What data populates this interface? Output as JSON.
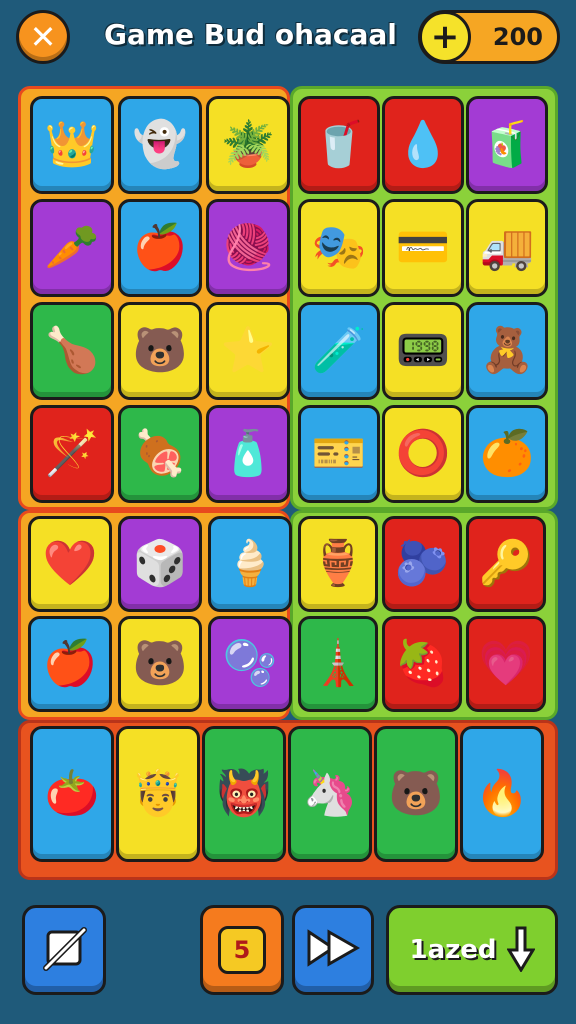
{
  "header": {
    "title": "Game Bud ohacaal",
    "coins": "200",
    "close_icon": "close-icon",
    "add_coins_icon": "plus-icon"
  },
  "board": {
    "tile_colors": {
      "blue": "#2fa7e8",
      "purple": "#a33bd4",
      "yellow": "#f5e025",
      "red": "#e0231c",
      "green": "#2eb84a"
    },
    "panel_a": [
      {
        "color": "blue",
        "icon": "crown-pot-icon",
        "glyph": "👑"
      },
      {
        "color": "blue",
        "icon": "king-ghost-icon",
        "glyph": "👻"
      },
      {
        "color": "yellow",
        "icon": "potted-plant-icon",
        "glyph": "🪴"
      },
      {
        "color": "purple",
        "icon": "carrot-slice-icon",
        "glyph": "🥕"
      },
      {
        "color": "blue",
        "icon": "apple-icon",
        "glyph": "🍎"
      },
      {
        "color": "purple",
        "icon": "yarn-ball-icon",
        "glyph": "🧶"
      },
      {
        "color": "green",
        "icon": "drumstick-icon",
        "glyph": "🍗"
      },
      {
        "color": "yellow",
        "icon": "bear-face-icon",
        "glyph": "🐻"
      },
      {
        "color": "yellow",
        "icon": "star-cherry-icon",
        "glyph": "⭐"
      },
      {
        "color": "red",
        "icon": "magic-wand-icon",
        "glyph": "🪄"
      },
      {
        "color": "green",
        "icon": "meat-leg-icon",
        "glyph": "🍖"
      },
      {
        "color": "purple",
        "icon": "bottle-icon",
        "glyph": "🧴"
      }
    ],
    "panel_b": [
      {
        "color": "red",
        "icon": "striped-cup-icon",
        "glyph": "🥤"
      },
      {
        "color": "red",
        "icon": "blue-leaf-icon",
        "glyph": "💧"
      },
      {
        "color": "purple",
        "icon": "glass-juice-icon",
        "glyph": "🧃"
      },
      {
        "color": "yellow",
        "icon": "feather-crown-icon",
        "glyph": "🎭"
      },
      {
        "color": "yellow",
        "icon": "card-icon",
        "glyph": "💳"
      },
      {
        "color": "yellow",
        "icon": "toy-truck-icon",
        "glyph": "🚚"
      },
      {
        "color": "blue",
        "icon": "potion-icon",
        "glyph": "🧪"
      },
      {
        "color": "yellow",
        "icon": "screen-icon",
        "glyph": "📟"
      },
      {
        "color": "blue",
        "icon": "bear-cup-icon",
        "glyph": "🧸"
      },
      {
        "color": "blue",
        "icon": "ticket-icon",
        "glyph": "🎫"
      },
      {
        "color": "yellow",
        "icon": "rings-icon",
        "glyph": "⭕"
      },
      {
        "color": "blue",
        "icon": "orange-icon",
        "glyph": "🍊"
      }
    ],
    "panel_c": [
      {
        "color": "yellow",
        "icon": "heart-icon",
        "glyph": "❤️"
      },
      {
        "color": "purple",
        "icon": "dice-card-icon",
        "glyph": "🎲"
      },
      {
        "color": "blue",
        "icon": "ice-cream-icon",
        "glyph": "🍦"
      },
      {
        "color": "blue",
        "icon": "apple-red-icon",
        "glyph": "🍎"
      },
      {
        "color": "yellow",
        "icon": "bear-mug-icon",
        "glyph": "🐻"
      },
      {
        "color": "purple",
        "icon": "washer-icon",
        "glyph": "🫧"
      }
    ],
    "panel_d": [
      {
        "color": "yellow",
        "icon": "crown-jar-icon",
        "glyph": "🏺"
      },
      {
        "color": "red",
        "icon": "gummy-icon",
        "glyph": "🫐"
      },
      {
        "color": "red",
        "icon": "bubble-key-icon",
        "glyph": "🔑"
      },
      {
        "color": "green",
        "icon": "tower-icon",
        "glyph": "🗼"
      },
      {
        "color": "red",
        "icon": "berry-icon",
        "glyph": "🍓"
      },
      {
        "color": "red",
        "icon": "pink-heart-icon",
        "glyph": "💗"
      }
    ],
    "panel_e": [
      {
        "color": "blue",
        "icon": "tomato-icon",
        "glyph": "🍅"
      },
      {
        "color": "yellow",
        "icon": "crown-creature-icon",
        "glyph": "🤴"
      },
      {
        "color": "green",
        "icon": "crown-gremlin-icon",
        "glyph": "👹"
      },
      {
        "color": "green",
        "icon": "pink-toy-icon",
        "glyph": "🦄"
      },
      {
        "color": "green",
        "icon": "bear-head-icon",
        "glyph": "🐻"
      },
      {
        "color": "blue",
        "icon": "fire-pot-icon",
        "glyph": "🔥"
      }
    ]
  },
  "footer": {
    "mute_icon": "mute-icon",
    "moves": "5",
    "play_icon": "fast-forward-icon",
    "load_label": "1azed",
    "down_icon": "arrow-down-icon"
  }
}
